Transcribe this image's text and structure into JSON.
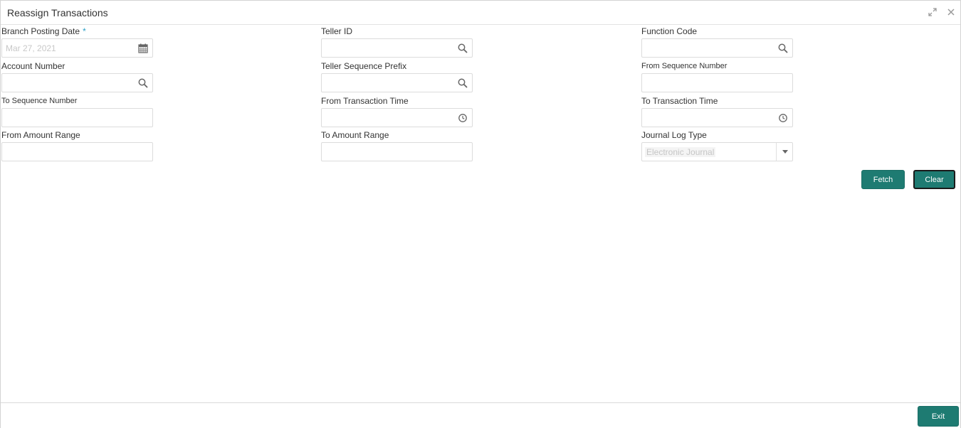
{
  "window": {
    "title": "Reassign Transactions"
  },
  "form": {
    "branch_posting_date": {
      "label": "Branch Posting Date",
      "required_marker": "*",
      "value": "Mar 27, 2021"
    },
    "teller_id": {
      "label": "Teller ID",
      "value": ""
    },
    "function_code": {
      "label": "Function Code",
      "value": ""
    },
    "account_number": {
      "label": "Account Number",
      "value": ""
    },
    "teller_sequence_prefix": {
      "label": "Teller Sequence Prefix",
      "value": ""
    },
    "from_sequence_number": {
      "label": "From Sequence Number",
      "value": ""
    },
    "to_sequence_number": {
      "label": "To Sequence Number",
      "value": ""
    },
    "from_transaction_time": {
      "label": "From Transaction Time",
      "value": ""
    },
    "to_transaction_time": {
      "label": "To Transaction Time",
      "value": ""
    },
    "from_amount_range": {
      "label": "From Amount Range",
      "value": ""
    },
    "to_amount_range": {
      "label": "To Amount Range",
      "value": ""
    },
    "journal_log_type": {
      "label": "Journal Log Type",
      "selected": "Electronic Journal"
    }
  },
  "actions": {
    "fetch_label": "Fetch",
    "clear_label": "Clear",
    "exit_label": "Exit"
  },
  "icons": {
    "expand": "expand-icon",
    "close": "close-icon",
    "calendar": "calendar-icon",
    "search": "search-icon",
    "clock": "clock-icon",
    "dropdown": "chevron-down-icon"
  },
  "colors": {
    "primary_button": "#1e7b72",
    "required_marker": "#2a9fc6"
  }
}
